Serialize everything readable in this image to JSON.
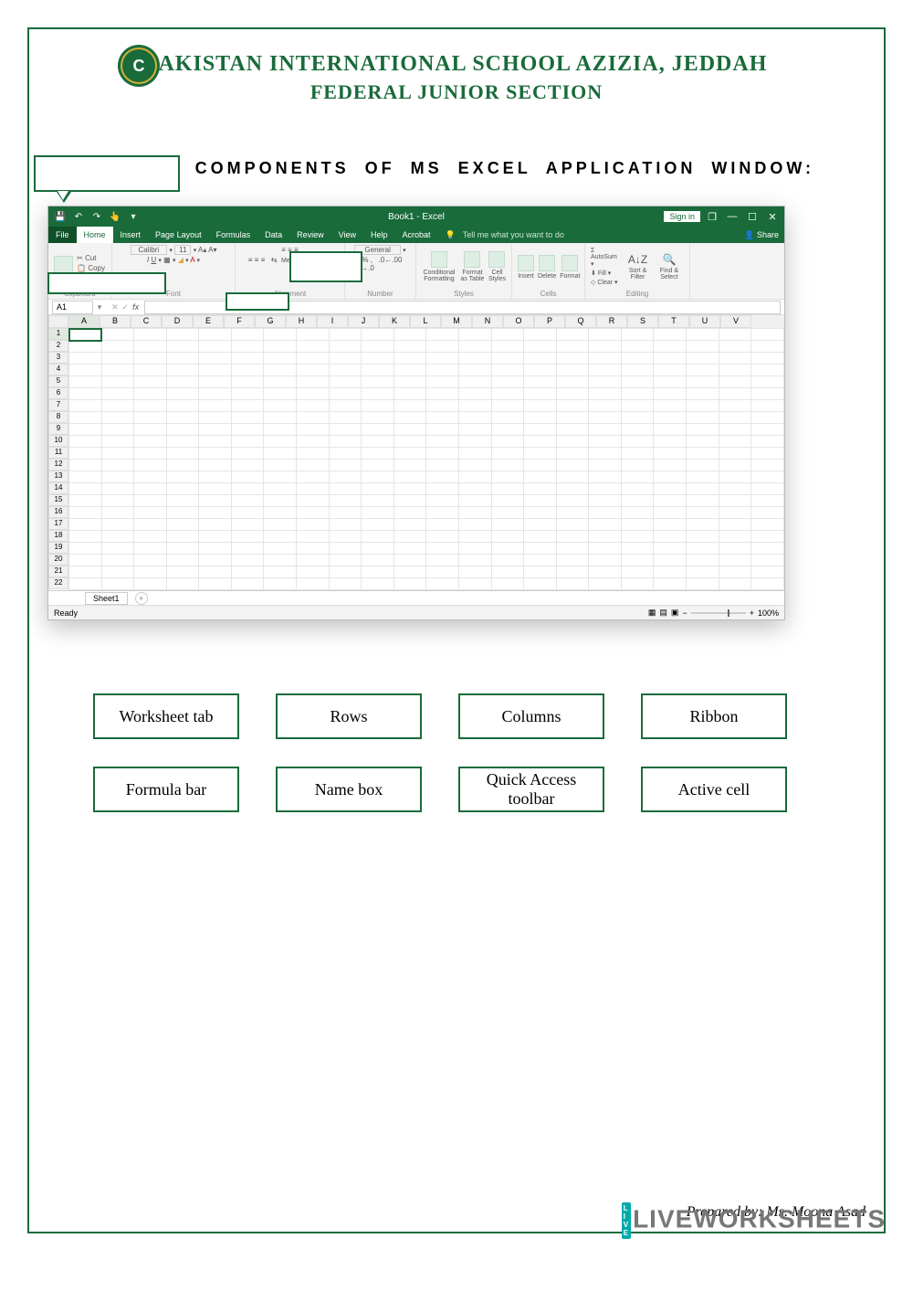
{
  "header": {
    "school_name": "PAKISTAN INTERNATIONAL SCHOOL AZIZIA, JEDDAH",
    "section_name": "FEDERAL JUNIOR SECTION",
    "logo_letter": "C"
  },
  "instruction": "LABEL  THE  COMPONENTS  OF  MS  EXCEL  APPLICATION  WINDOW:",
  "excel": {
    "title": "Book1 - Excel",
    "sign_in": "Sign in",
    "win_buttons": [
      "❐",
      "—",
      "☐",
      "✕"
    ],
    "tabs": [
      "File",
      "Home",
      "Insert",
      "Page Layout",
      "Formulas",
      "Data",
      "Review",
      "View",
      "Help",
      "Acrobat"
    ],
    "tell_me": "Tell me what you want to do",
    "share": "Share",
    "clipboard": {
      "cut": "Cut",
      "copy": "Copy",
      "label": "Clipboard"
    },
    "font_group": {
      "font_name": "Calibri",
      "size": "11",
      "label": "Font"
    },
    "alignment": {
      "merge": "Merge & Center",
      "label": "Alignment"
    },
    "number": {
      "format": "General",
      "label": "Number"
    },
    "styles": {
      "cond": "Conditional Formatting",
      "fmt": "Format as Table",
      "cell": "Cell Styles",
      "label": "Styles"
    },
    "cells": {
      "insert": "Insert",
      "delete": "Delete",
      "format": "Format",
      "label": "Cells"
    },
    "editing": {
      "sum": "AutoSum",
      "fill": "Fill",
      "clear": "Clear",
      "sort": "Sort & Filter",
      "find": "Find & Select",
      "label": "Editing"
    },
    "namebox": "A1",
    "fx": "fx",
    "columns": [
      "A",
      "B",
      "C",
      "D",
      "E",
      "F",
      "G",
      "H",
      "I",
      "J",
      "K",
      "L",
      "M",
      "N",
      "O",
      "P",
      "Q",
      "R",
      "S",
      "T",
      "U",
      "V"
    ],
    "rows": [
      "1",
      "2",
      "3",
      "4",
      "5",
      "6",
      "7",
      "8",
      "9",
      "10",
      "11",
      "12",
      "13",
      "14",
      "15",
      "16",
      "17",
      "18",
      "19",
      "20",
      "21",
      "22"
    ],
    "sheet_tab": "Sheet1",
    "plus": "+",
    "ready": "Ready",
    "zoom": "100%"
  },
  "bank": {
    "row1": [
      "Worksheet tab",
      "Rows",
      "Columns",
      "Ribbon"
    ],
    "row2": [
      "Formula bar",
      "Name box",
      "Quick Access toolbar",
      "Active cell"
    ]
  },
  "footer": "Prepared by: Ms. Moona Asad",
  "watermark": "LIVEWORKSHEETS",
  "watermark_tag": [
    "L",
    "I",
    "V",
    "E"
  ]
}
